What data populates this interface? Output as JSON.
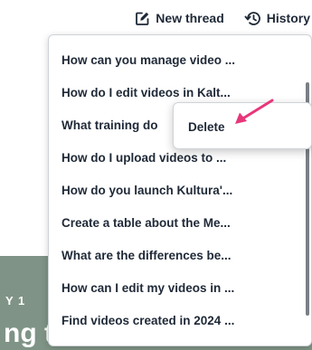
{
  "toolbar": {
    "new_thread_label": "New thread",
    "history_label": "History"
  },
  "history_menu": {
    "items": [
      "How can you manage video ...",
      "How do I edit videos in Kalt...",
      "What training do",
      "How do I upload videos to ...",
      "How do you launch Kultura'...",
      "Create a table about the Me...",
      "What are the differences be...",
      "How can I edit my videos in ...",
      "Find videos created in 2024 ..."
    ]
  },
  "context_menu": {
    "delete_label": "Delete"
  },
  "hero": {
    "eyebrow": "Y 1",
    "title": "ng the"
  },
  "colors": {
    "hero_bg": "#7f9486",
    "annotation_arrow": "#e8367a"
  },
  "icons": {
    "new_thread": "edit-square-icon",
    "history": "history-clock-icon",
    "annotation": "pink-arrow-icon"
  }
}
